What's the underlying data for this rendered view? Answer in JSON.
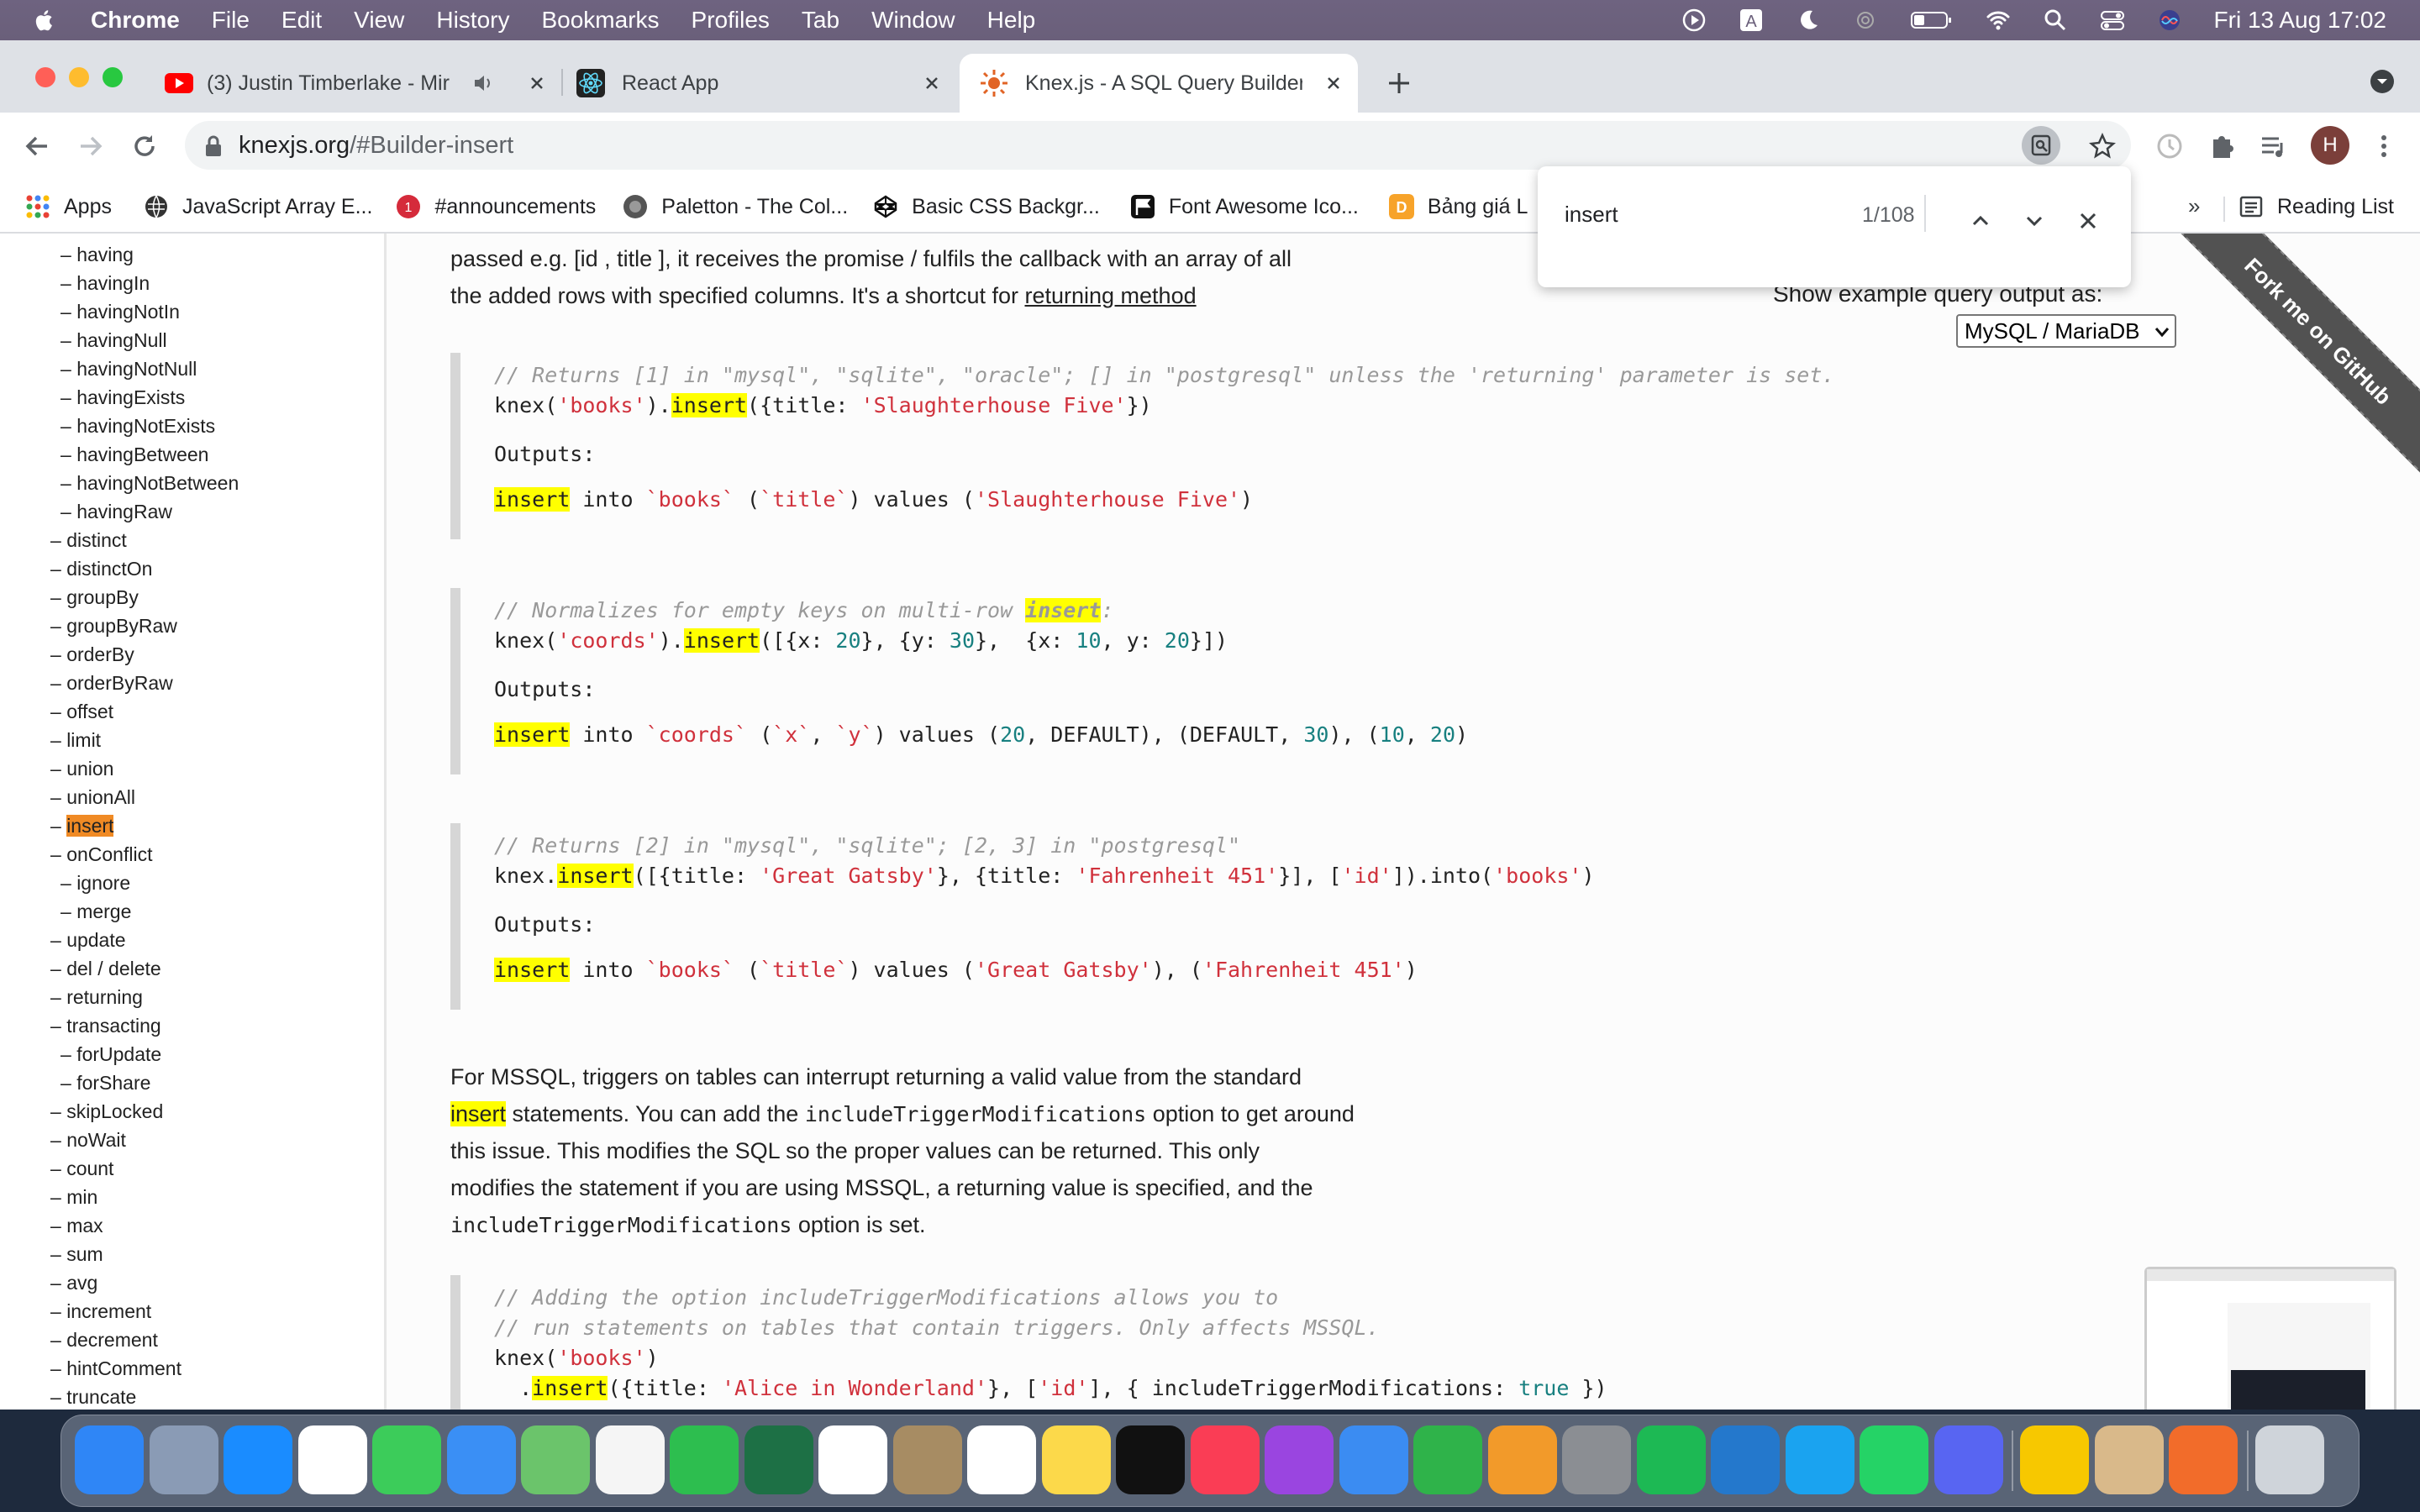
{
  "menubar": {
    "app": "Chrome",
    "items": [
      "File",
      "Edit",
      "View",
      "History",
      "Bookmarks",
      "Profiles",
      "Tab",
      "Window",
      "Help"
    ],
    "clock": "Fri 13 Aug  17:02"
  },
  "tabs": [
    {
      "title": "(3) Justin Timberlake - Mir"
    },
    {
      "title": "React App"
    },
    {
      "title": "Knex.js - A SQL Query Builder f"
    }
  ],
  "address": {
    "host": "knexjs.org",
    "path": "/#Builder-insert"
  },
  "bookmarks": [
    "Apps",
    "JavaScript Array E...",
    "#announcements",
    "Paletton - The Col...",
    "Basic CSS Backgr...",
    "Font Awesome Ico...",
    "Bảng giá L"
  ],
  "reading_list": "Reading List",
  "profile_initial": "H",
  "find": {
    "query": "insert",
    "count": "1/108"
  },
  "sidebar": {
    "items": [
      {
        "label": "having",
        "level": 2
      },
      {
        "label": "havingIn",
        "level": 2
      },
      {
        "label": "havingNotIn",
        "level": 2
      },
      {
        "label": "havingNull",
        "level": 2
      },
      {
        "label": "havingNotNull",
        "level": 2
      },
      {
        "label": "havingExists",
        "level": 2
      },
      {
        "label": "havingNotExists",
        "level": 2
      },
      {
        "label": "havingBetween",
        "level": 2
      },
      {
        "label": "havingNotBetween",
        "level": 2
      },
      {
        "label": "havingRaw",
        "level": 2
      },
      {
        "label": "distinct",
        "level": 1
      },
      {
        "label": "distinctOn",
        "level": 1
      },
      {
        "label": "groupBy",
        "level": 1
      },
      {
        "label": "groupByRaw",
        "level": 1
      },
      {
        "label": "orderBy",
        "level": 1
      },
      {
        "label": "orderByRaw",
        "level": 1
      },
      {
        "label": "offset",
        "level": 1
      },
      {
        "label": "limit",
        "level": 1
      },
      {
        "label": "union",
        "level": 1
      },
      {
        "label": "unionAll",
        "level": 1
      },
      {
        "label": "insert",
        "level": 1,
        "active": true
      },
      {
        "label": "onConflict",
        "level": 1
      },
      {
        "label": "ignore",
        "level": 2
      },
      {
        "label": "merge",
        "level": 2
      },
      {
        "label": "update",
        "level": 1
      },
      {
        "label": "del / delete",
        "level": 1
      },
      {
        "label": "returning",
        "level": 1
      },
      {
        "label": "transacting",
        "level": 1
      },
      {
        "label": "forUpdate",
        "level": 2
      },
      {
        "label": "forShare",
        "level": 2
      },
      {
        "label": "skipLocked",
        "level": 1
      },
      {
        "label": "noWait",
        "level": 1
      },
      {
        "label": "count",
        "level": 1
      },
      {
        "label": "min",
        "level": 1
      },
      {
        "label": "max",
        "level": 1
      },
      {
        "label": "sum",
        "level": 1
      },
      {
        "label": "avg",
        "level": 1
      },
      {
        "label": "increment",
        "level": 1
      },
      {
        "label": "decrement",
        "level": 1
      },
      {
        "label": "hintComment",
        "level": 1
      },
      {
        "label": "truncate",
        "level": 1
      }
    ]
  },
  "content": {
    "intro_line1": "passed e.g. [id , title ], it receives the promise / fulfils the callback with an array of all",
    "intro_line2_prefix": "the added rows with specified columns. It's a shortcut for ",
    "intro_link": "returning method",
    "example_label": "Show example query output as:",
    "dialect": "MySQL / MariaDB",
    "outputs_label": "Outputs:",
    "ribbon": "Fork me on GitHub",
    "mssql_lines": [
      "For MSSQL, triggers on tables can interrupt returning a valid value from the standard",
      "statements. You can add the",
      "includeTriggerModifications",
      "option to get around",
      "this issue. This modifies the SQL so the proper values can be returned. This only",
      "modifies the statement if you are using MSSQL, a returning value is specified, and the",
      "option is set."
    ],
    "highlight_word": "insert"
  },
  "colors": {
    "accent": "#f08a24",
    "find_highlight": "#ffff00",
    "string": "#d0313c",
    "number": "#188080",
    "comment": "#999999"
  }
}
